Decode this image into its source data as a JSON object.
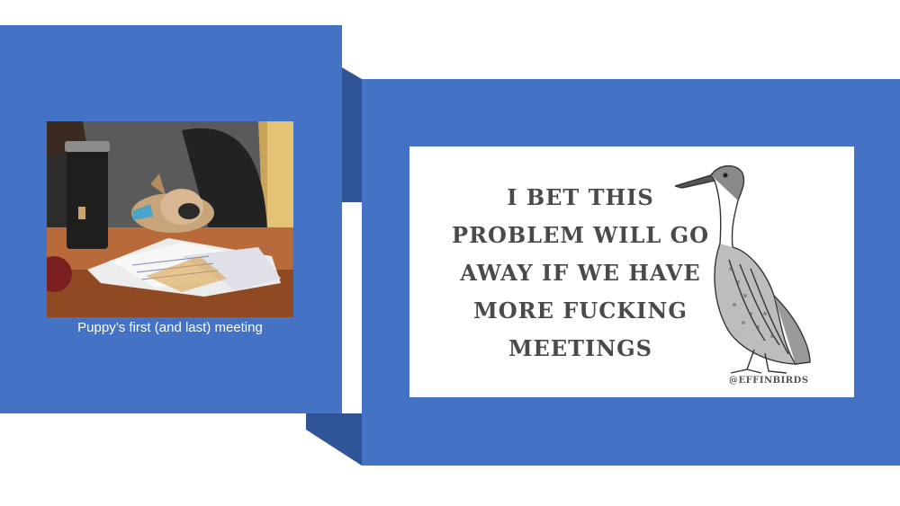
{
  "slide": {
    "photo": {
      "caption": "Puppy’s first (and last) meeting",
      "icon": "puppy-on-desk-photo"
    },
    "meme": {
      "lines": [
        "I BET THIS",
        "PROBLEM WILL GO",
        "AWAY IF WE HAVE",
        "MORE FUCKING",
        "MEETINGS"
      ],
      "handle": "@EFFINBIRDS",
      "icon": "duck-illustration"
    },
    "colors": {
      "panel": "#4472c4",
      "panel_shadow": "#2f5597",
      "background": "#ffffff"
    }
  }
}
